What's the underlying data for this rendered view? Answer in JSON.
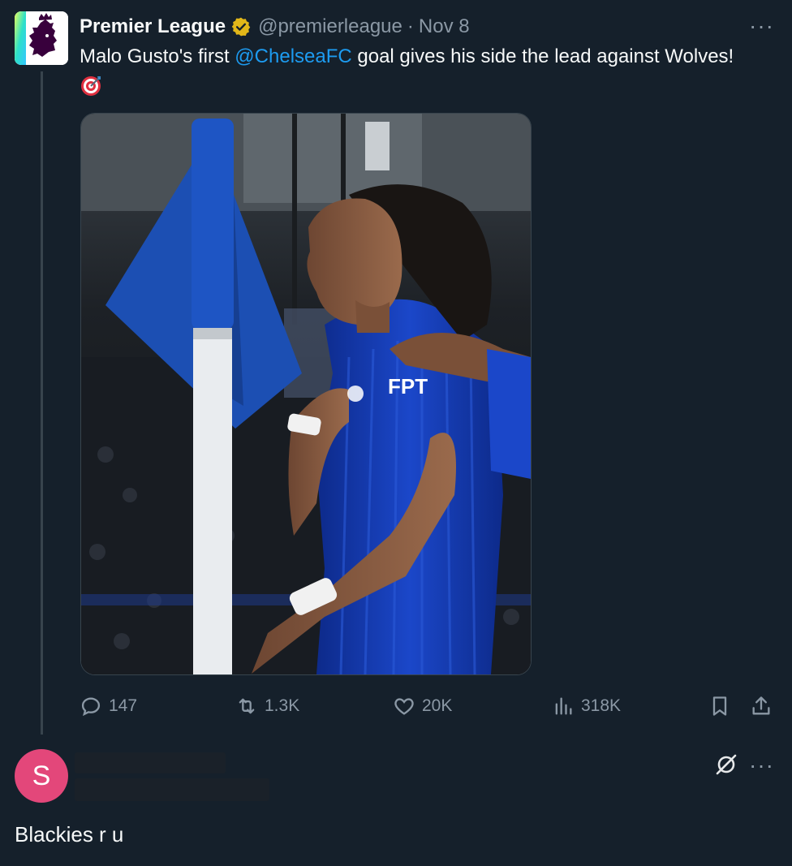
{
  "tweet": {
    "display_name": "Premier League",
    "handle": "@premierleague",
    "separator": "·",
    "date": "Nov 8",
    "more": "···",
    "text_before": "Malo Gusto's first ",
    "mention": "@ChelseaFC",
    "text_after": " goal gives his side the lead against Wolves!",
    "media_text": "FPT",
    "actions": {
      "replies": "147",
      "retweets": "1.3K",
      "likes": "20K",
      "views": "318K"
    }
  },
  "reply": {
    "avatar_letter": "S",
    "more": "···",
    "text": "Blackies r u"
  },
  "colors": {
    "background": "#15202b",
    "accent": "#1d9bf0",
    "secondary_text": "#8b98a5",
    "verified_gold": "#e2b719",
    "reply_avatar": "#e3477a"
  }
}
